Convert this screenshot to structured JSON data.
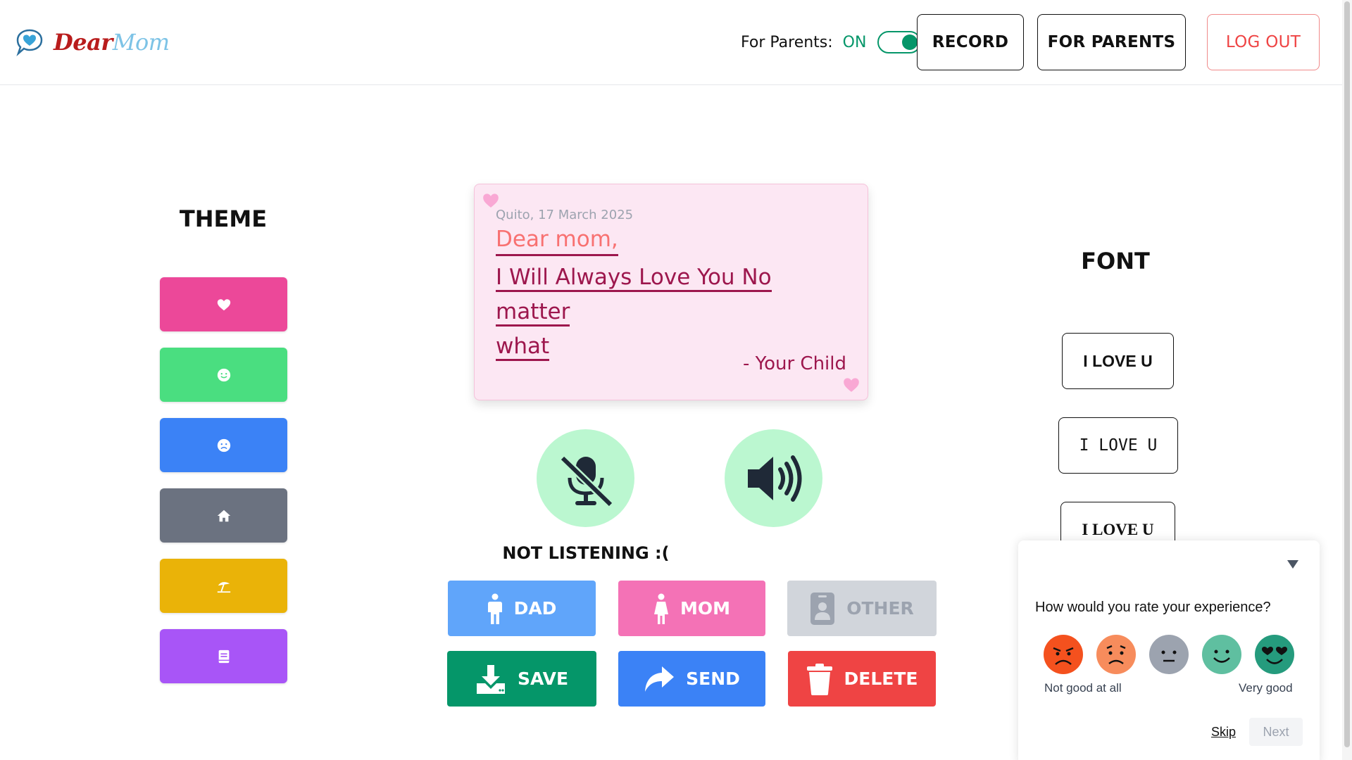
{
  "header": {
    "logo_dear": "Dear",
    "logo_mom": "Mom",
    "parents_label": "For Parents:",
    "parents_state": "ON",
    "record_label": "RECORD",
    "for_parents_label": "FOR PARENTS",
    "logout_label": "LOG OUT"
  },
  "theme": {
    "title": "THEME",
    "buttons": [
      {
        "icon": "heart-icon",
        "color": "#ec4899"
      },
      {
        "icon": "smile-icon",
        "color": "#4ade80"
      },
      {
        "icon": "sad-icon",
        "color": "#3b82f6"
      },
      {
        "icon": "home-icon",
        "color": "#6b7280"
      },
      {
        "icon": "umbrella-beach-icon",
        "color": "#eab308"
      },
      {
        "icon": "book-icon",
        "color": "#a855f7"
      }
    ]
  },
  "letter": {
    "date": "Quito, 17 March 2025",
    "greeting": "Dear mom,",
    "body_line1": "I Will Always Love You No matter",
    "body_line2": "what",
    "signature": "- Your Child"
  },
  "audio": {
    "status": "NOT LISTENING :("
  },
  "recipients": {
    "dad": "DAD",
    "mom": "MOM",
    "other": "OTHER"
  },
  "actions": {
    "save": "SAVE",
    "send": "SEND",
    "delete": "DELETE"
  },
  "font": {
    "title": "FONT",
    "options": [
      "I LOVE U",
      "I LOVE U",
      "I LOVE U"
    ]
  },
  "survey": {
    "question": "How would you rate your experience?",
    "low_label": "Not good at all",
    "high_label": "Very good",
    "skip": "Skip",
    "next": "Next",
    "faces": [
      {
        "icon": "angry-face-icon",
        "color": "#f4511e"
      },
      {
        "icon": "sad-face-icon",
        "color": "#f78c5c"
      },
      {
        "icon": "neutral-face-icon",
        "color": "#9ca3af"
      },
      {
        "icon": "smile-face-icon",
        "color": "#5fbfa0"
      },
      {
        "icon": "love-face-icon",
        "color": "#259b7d"
      }
    ]
  }
}
